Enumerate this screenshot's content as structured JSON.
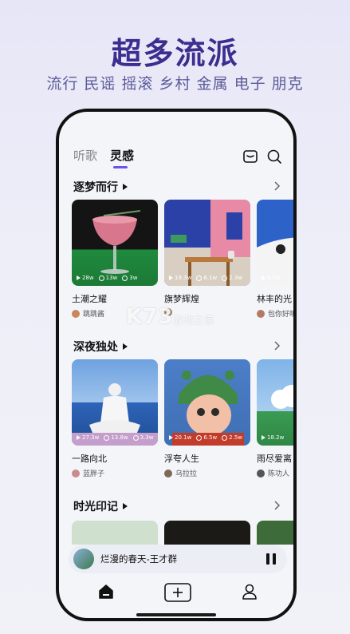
{
  "promo": {
    "headline": "超多流派",
    "subline": "流行 民谣 摇滚 乡村 金属 电子 朋克"
  },
  "tabs": [
    {
      "label": "听歌",
      "active": false
    },
    {
      "label": "灵感",
      "active": true
    }
  ],
  "top_icons": [
    "inbox-icon",
    "search-icon"
  ],
  "sections": [
    {
      "title": "逐梦而行",
      "cards": [
        {
          "title": "土潮之耀",
          "author": "跳跳酱",
          "plays": "28w",
          "likes": "13w",
          "remixes": "3w"
        },
        {
          "title": "旗梦辉煌",
          "author": "",
          "plays": "19.3w",
          "likes": "6.1w",
          "remixes": "2.3w"
        },
        {
          "title": "林丰的光",
          "author": "包你好听",
          "plays": "8.9w",
          "likes": "",
          "remixes": ""
        }
      ]
    },
    {
      "title": "深夜独处",
      "cards": [
        {
          "title": "一路向北",
          "author": "蓝胖子",
          "plays": "27.3w",
          "likes": "13.8w",
          "remixes": "3.3w"
        },
        {
          "title": "浮夸人生",
          "author": "乌拉拉",
          "plays": "20.1w",
          "likes": "6.5w",
          "remixes": "2.5w"
        },
        {
          "title": "雨尽爱离",
          "author": "陈功人",
          "plays": "18.2w",
          "likes": "",
          "remixes": ""
        }
      ]
    },
    {
      "title": "时光印记",
      "cards": []
    }
  ],
  "watermark": {
    "main": "K73",
    "sub": "游戏之家"
  },
  "player": {
    "title": "烂漫的春天-王才群",
    "state": "playing"
  },
  "bottom_nav": [
    "home-icon",
    "add-icon",
    "profile-icon"
  ],
  "colors": {
    "accent": "#6b55e8",
    "headline": "#3a2f8f",
    "subline": "#5b5b9a"
  }
}
